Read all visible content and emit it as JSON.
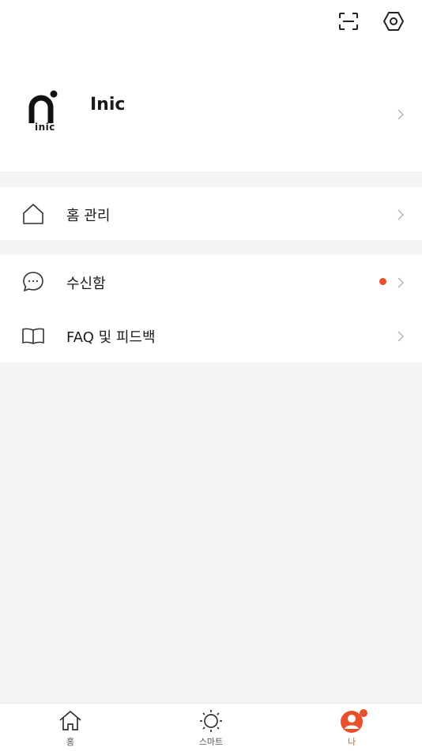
{
  "header": {
    "scan_icon": "scan-icon",
    "settings_icon": "hexagon-settings-icon"
  },
  "profile": {
    "logo_text": "inic",
    "name": "Inic"
  },
  "menu": {
    "home_manage": {
      "label": "홈 관리",
      "icon": "home-outline-icon"
    },
    "inbox": {
      "label": "수신함",
      "icon": "chat-bubble-icon",
      "has_unread": true
    },
    "faq": {
      "label": "FAQ 및 피드백",
      "icon": "book-icon"
    }
  },
  "tabs": [
    {
      "label": "홈",
      "icon": "home-icon",
      "active": false
    },
    {
      "label": "스마트",
      "icon": "sun-icon",
      "active": false
    },
    {
      "label": "나",
      "icon": "user-circle-icon",
      "active": true
    }
  ],
  "colors": {
    "accent": "#e8502c",
    "background": "#f5f5f5",
    "surface": "#ffffff"
  }
}
